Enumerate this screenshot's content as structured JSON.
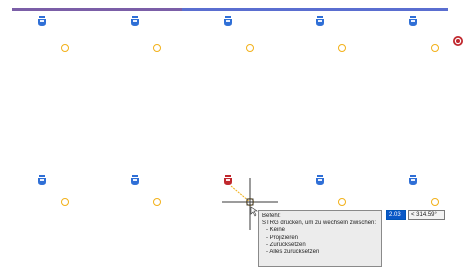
{
  "colors": {
    "bar_purple": "#7b5ea7",
    "bar_blue": "#5a6ed0",
    "grip_blue": "#2f6fd6",
    "grip_red": "#c0282e",
    "circle_orange": "#f2b11a",
    "crosshair": "#3a3a3a",
    "trace": "#f2b11a",
    "selection_blue": "#0a58c7"
  },
  "icons": {
    "grip": "blue-grip-icon",
    "grip_active": "red-grip-icon",
    "node": "orange-circle-node-icon",
    "endpoint": "red-circle-marker-icon",
    "cursor": "crosshair-cursor-icon"
  },
  "tooltip": {
    "title": "Befehl:",
    "line1": "STRG drücken, um zu wechseln zwischen:",
    "options": [
      "- Keine",
      "- Projizieren",
      "- Zurücksetzen",
      "- Alles zurücksetzen"
    ]
  },
  "dynamic_input": {
    "distance_value": "2.03",
    "angle_value": "< 314.59°"
  }
}
